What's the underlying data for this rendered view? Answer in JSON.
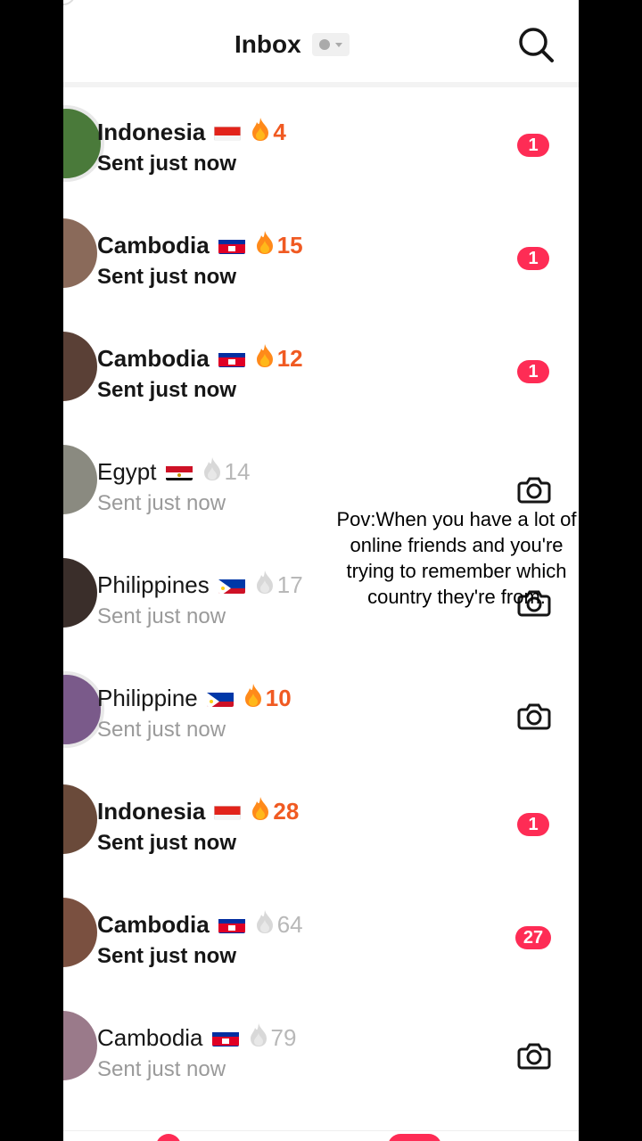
{
  "header": {
    "title": "Inbox",
    "search_icon": "search-icon",
    "status_icon": "status-dot-icon"
  },
  "conversations": [
    {
      "name": "Indonesia",
      "flag": "indonesia-flag",
      "streak": "4",
      "streak_active": true,
      "status": "Sent just now",
      "unread": true,
      "badge": "1"
    },
    {
      "name": "Cambodia",
      "flag": "cambodia-flag",
      "streak": "15",
      "streak_active": true,
      "status": "Sent just now",
      "unread": true,
      "badge": "1"
    },
    {
      "name": "Cambodia",
      "flag": "cambodia-flag",
      "streak": "12",
      "streak_active": true,
      "status": "Sent just now",
      "unread": true,
      "badge": "1"
    },
    {
      "name": "Egypt",
      "flag": "egypt-flag",
      "streak": "14",
      "streak_active": false,
      "status": "Sent just now",
      "unread": false,
      "action_icon": "camera-icon"
    },
    {
      "name": "Philippines",
      "flag": "philippines-flag",
      "streak": "17",
      "streak_active": false,
      "status": "Sent just now",
      "unread": false,
      "action_icon": "camera-icon"
    },
    {
      "name": "Philippine",
      "flag": "philippines-flag",
      "streak": "10",
      "streak_active": true,
      "status": "Sent just now",
      "unread": false,
      "action_icon": "camera-icon"
    },
    {
      "name": "Indonesia",
      "flag": "indonesia-flag",
      "streak": "28",
      "streak_active": true,
      "status": "Sent just now",
      "unread": true,
      "badge": "1"
    },
    {
      "name": "Cambodia",
      "flag": "cambodia-flag",
      "streak": "64",
      "streak_active": false,
      "status": "Sent just now",
      "unread": true,
      "badge": "27"
    },
    {
      "name": "Cambodia",
      "flag": "cambodia-flag",
      "streak": "79",
      "streak_active": false,
      "status": "Sent just now",
      "unread": false,
      "action_icon": "camera-icon"
    }
  ],
  "overlay_caption": "Pov:When you have a lot of online friends and you're trying to remember which country they're from.",
  "colors": {
    "accent": "#fe2c55",
    "streak_active": "#f05a22",
    "streak_inactive": "#b8b8b8",
    "text_muted": "#9a9a9a"
  }
}
